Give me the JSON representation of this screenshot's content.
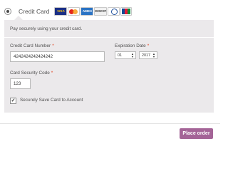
{
  "payment_method": {
    "label": "Credit Card",
    "selected": true,
    "card_logos": [
      {
        "name": "visa-logo",
        "text": "VISA"
      },
      {
        "name": "mastercard-logo",
        "text": ""
      },
      {
        "name": "amex-logo",
        "text": "AMEX"
      },
      {
        "name": "discover-logo",
        "text": "DISCOVER"
      },
      {
        "name": "diners-club-logo",
        "text": ""
      },
      {
        "name": "jcb-logo",
        "text": "JCB"
      }
    ]
  },
  "form": {
    "intro": "Pay securely using your credit card.",
    "card_number_label": "Credit Card Number",
    "card_number_value": "4242424242424242",
    "expiration_label": "Expiration Date",
    "exp_month_value": "01",
    "exp_year_value": "2017",
    "security_code_label": "Card Security Code",
    "security_code_value": "123",
    "save_card_label": "Securely Save Card to Account",
    "save_card_checked": true,
    "required_mark": "*"
  },
  "actions": {
    "place_order_label": "Place order"
  },
  "colors": {
    "panel_bg": "#ebe9eb",
    "button_bg": "#a46497",
    "required": "#e2401c"
  }
}
